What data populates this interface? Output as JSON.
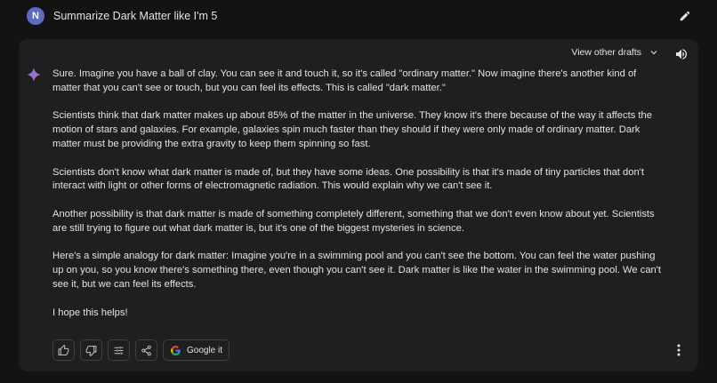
{
  "prompt": {
    "avatar_letter": "N",
    "text": "Summarize Dark Matter like I'm 5"
  },
  "drafts": {
    "label": "View other drafts"
  },
  "response": {
    "paragraphs": [
      "Sure. Imagine you have a ball of clay. You can see it and touch it, so it's called \"ordinary matter.\" Now imagine there's another kind of matter that you can't see or touch, but you can feel its effects. This is called \"dark matter.\"",
      "Scientists think that dark matter makes up about 85% of the matter in the universe. They know it's there because of the way it affects the motion of stars and galaxies. For example, galaxies spin much faster than they should if they were only made of ordinary matter. Dark matter must be providing the extra gravity to keep them spinning so fast.",
      "Scientists don't know what dark matter is made of, but they have some ideas. One possibility is that it's made of tiny particles that don't interact with light or other forms of electromagnetic radiation. This would explain why we can't see it.",
      "Another possibility is that dark matter is made of something completely different, something that we don't even know about yet. Scientists are still trying to figure out what dark matter is, but it's one of the biggest mysteries in science.",
      "Here's a simple analogy for dark matter: Imagine you're in a swimming pool and you can't see the bottom. You can feel the water pushing up on you, so you know there's something there, even though you can't see it. Dark matter is like the water in the swimming pool. We can't see it, but we can feel its effects.",
      "I hope this helps!"
    ]
  },
  "actions": {
    "google_label": "Google it"
  },
  "icons": {
    "edit": "pencil-icon",
    "drafts": "chevron-down-icon",
    "speaker": "speaker-icon",
    "spark": "sparkle-icon",
    "thumbs_up": "thumbs-up-icon",
    "thumbs_down": "thumbs-down-icon",
    "modify": "tune-icon",
    "share": "share-icon",
    "google": "google-g-icon",
    "more": "more-vert-icon"
  },
  "colors": {
    "background": "#131314",
    "card": "#1e1f20",
    "avatar": "#5c6bc0",
    "text": "#e3e3e3"
  }
}
